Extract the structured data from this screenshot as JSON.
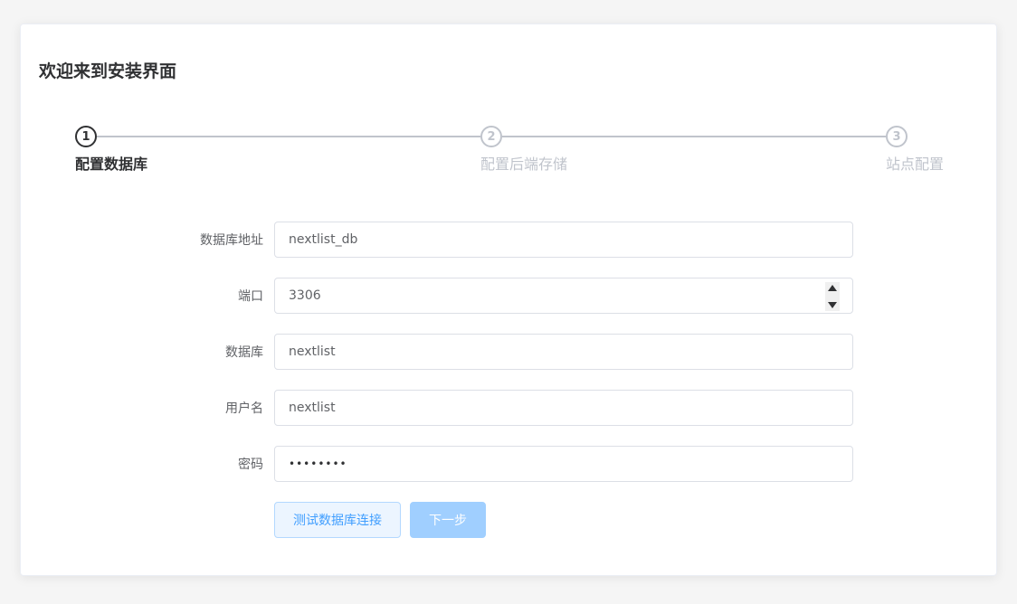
{
  "page": {
    "title": "欢迎来到安装界面"
  },
  "steps": [
    {
      "number": "1",
      "title": "配置数据库",
      "state": "active"
    },
    {
      "number": "2",
      "title": "配置后端存储",
      "state": "wait"
    },
    {
      "number": "3",
      "title": "站点配置",
      "state": "wait"
    }
  ],
  "form": {
    "host": {
      "label": "数据库地址",
      "value": "nextlist_db"
    },
    "port": {
      "label": "端口",
      "value": "3306"
    },
    "database": {
      "label": "数据库",
      "value": "nextlist"
    },
    "username": {
      "label": "用户名",
      "value": "nextlist"
    },
    "password": {
      "label": "密码",
      "value": "••••••••"
    }
  },
  "actions": {
    "test_label": "测试数据库连接",
    "next_label": "下一步"
  },
  "colors": {
    "primary": "#409eff",
    "primary_disabled": "#a0cfff",
    "border": "#dcdfe6",
    "step_inactive": "#c0c4cc",
    "text_primary": "#303133"
  }
}
